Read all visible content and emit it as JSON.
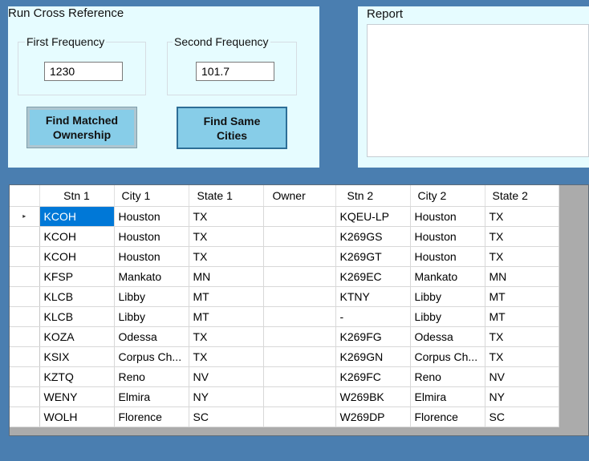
{
  "cross_reference": {
    "group_title": "Run Cross Reference",
    "first_frequency_label": "First Frequency",
    "first_frequency_value": "1230",
    "second_frequency_label": "Second Frequency",
    "second_frequency_value": "101.7",
    "find_matched_ownership_label": "Find Matched Ownership",
    "find_same_cities_label": "Find Same Cities"
  },
  "report": {
    "group_title": "Report",
    "text": ""
  },
  "grid": {
    "row_indicator": "▸",
    "columns": [
      "Stn 1",
      "City 1",
      "State 1",
      "Owner",
      "Stn 2",
      "City 2",
      "State 2"
    ],
    "rows": [
      [
        "KCOH",
        "Houston",
        "TX",
        "",
        "KQEU-LP",
        "Houston",
        "TX"
      ],
      [
        "KCOH",
        "Houston",
        "TX",
        "",
        "K269GS",
        "Houston",
        "TX"
      ],
      [
        "KCOH",
        "Houston",
        "TX",
        "",
        "K269GT",
        "Houston",
        "TX"
      ],
      [
        "KFSP",
        "Mankato",
        "MN",
        "",
        "K269EC",
        "Mankato",
        "MN"
      ],
      [
        "KLCB",
        "Libby",
        "MT",
        "",
        "KTNY",
        "Libby",
        "MT"
      ],
      [
        "KLCB",
        "Libby",
        "MT",
        "",
        "-",
        "Libby",
        "MT"
      ],
      [
        "KOZA",
        "Odessa",
        "TX",
        "",
        "K269FG",
        "Odessa",
        "TX"
      ],
      [
        "KSIX",
        "Corpus Ch...",
        "TX",
        "",
        "K269GN",
        "Corpus Ch...",
        "TX"
      ],
      [
        "KZTQ",
        "Reno",
        "NV",
        "",
        "K269FC",
        "Reno",
        "NV"
      ],
      [
        "WENY",
        "Elmira",
        "NY",
        "",
        "W269BK",
        "Elmira",
        "NY"
      ],
      [
        "WOLH",
        "Florence",
        "SC",
        "",
        "W269DP",
        "Florence",
        "SC"
      ]
    ]
  }
}
